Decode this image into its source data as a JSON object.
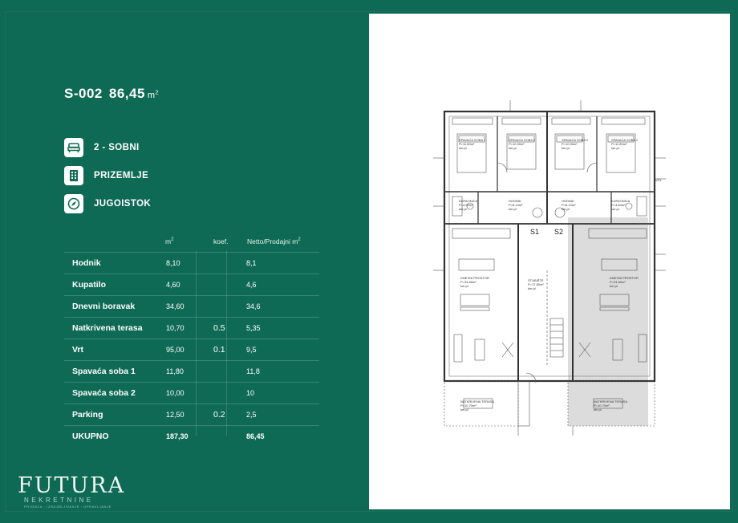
{
  "header": {
    "ghost_title": "",
    "unit_code": "S-002",
    "area_value": "86,45",
    "area_unit": "m",
    "area_unit_exp": "2"
  },
  "features": [
    {
      "icon": "bed-icon",
      "label": "2 - SOBNI"
    },
    {
      "icon": "building-icon",
      "label": "PRIZEMLJE"
    },
    {
      "icon": "compass-icon",
      "label": "JUGOISTOK"
    }
  ],
  "table": {
    "headers": {
      "m2": "m",
      "m2_exp": "2",
      "koef": "koef.",
      "netto": "Netto/Prodajni m",
      "netto_exp": "2"
    },
    "rows": [
      {
        "name": "Hodnik",
        "m2": "8,10",
        "koef": "",
        "netto": "8,1"
      },
      {
        "name": "Kupatilo",
        "m2": "4,60",
        "koef": "",
        "netto": "4,6"
      },
      {
        "name": "Dnevni boravak",
        "m2": "34,60",
        "koef": "",
        "netto": "34,6"
      },
      {
        "name": "Natkrivena terasa",
        "m2": "10,70",
        "koef": "0.5",
        "netto": "5,35"
      },
      {
        "name": "Vrt",
        "m2": "95,00",
        "koef": "0.1",
        "netto": "9,5"
      },
      {
        "name": "Spavaća soba 1",
        "m2": "11,80",
        "koef": "",
        "netto": "11,8"
      },
      {
        "name": "Spavaća soba 2",
        "m2": "10,00",
        "koef": "",
        "netto": "10"
      },
      {
        "name": "Parking",
        "m2": "12,50",
        "koef": "0.2",
        "netto": "2,5"
      }
    ],
    "total": {
      "name": "UKUPNO",
      "m2": "187,30",
      "netto": "86,45"
    }
  },
  "logo": {
    "wordmark": "FUTURA",
    "subtitle": "NEKRETNINE",
    "tagline": "PRODAJA · IZNAJMLJIVANJE · UPRAVLJANJE"
  },
  "plan": {
    "rooms": [
      {
        "id": "spavaca-soba-1-left",
        "lines": [
          "SPAVAĆA SOBA 1",
          "P=11.80m²",
          "ker.pl."
        ]
      },
      {
        "id": "spavaca-soba-2-left",
        "lines": [
          "SPAVAĆA SOBA 2",
          "P=10.00m²",
          "ker.pl."
        ]
      },
      {
        "id": "spavaca-soba-2-right",
        "lines": [
          "SPAVAĆA SOBA 2",
          "P=10.00m²",
          "ker.pl."
        ]
      },
      {
        "id": "spavaca-soba-1-right",
        "lines": [
          "SPAVAĆA SOBA 1",
          "P=11.80m²",
          "ker.pl."
        ]
      },
      {
        "id": "kupaonica-left",
        "lines": [
          "KUPAONICA",
          "P=4.60m²",
          "ker.pl."
        ]
      },
      {
        "id": "hodnik-left",
        "lines": [
          "HODNIK",
          "P=8.10m²",
          "ker.pl."
        ]
      },
      {
        "id": "hodnik-right",
        "lines": [
          "HODNIK",
          "P=8.10m²",
          "ker.pl."
        ]
      },
      {
        "id": "kupaonica-right",
        "lines": [
          "KUPAONICA",
          "P=4.60m²",
          "ker.pl."
        ]
      },
      {
        "id": "dnevni-prostor-left",
        "lines": [
          "DNEVNI PROSTOR",
          "P=34.60m²",
          "ker.pl."
        ]
      },
      {
        "id": "stubiste",
        "lines": [
          "STUBIŠTE",
          "P=17.80m²",
          "ker.pl."
        ]
      },
      {
        "id": "dnevni-prostor-right",
        "lines": [
          "DNEVNI PROSTOR",
          "P=34.60m²",
          "ker.pl."
        ]
      },
      {
        "id": "terasa-left",
        "lines": [
          "NATKRIVENA TERASA",
          "P=10.70m²",
          "ker.pl."
        ]
      },
      {
        "id": "terasa-right",
        "lines": [
          "NATKRIVENA TERASA",
          "P=10.70m²",
          "ker.pl."
        ]
      }
    ],
    "stair_tags": [
      "S1",
      "S2"
    ],
    "section_tag": "VZ1"
  },
  "colors": {
    "background": "#0f6a55",
    "panel": "#ffffff",
    "highlight": "#d9d9d9"
  }
}
